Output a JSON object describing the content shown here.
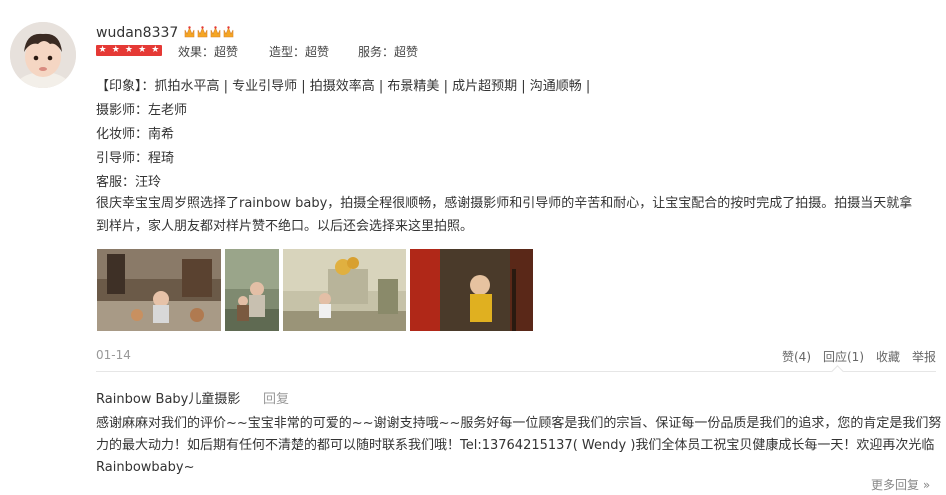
{
  "review": {
    "username": "wudan8337",
    "crown_count": 4,
    "star_rating": 5,
    "scores": [
      {
        "label": "效果：超赞"
      },
      {
        "label": "造型：超赞"
      },
      {
        "label": "服务：超赞"
      }
    ],
    "impression": "【印象】：抓拍水平高 | 专业引导师 | 拍摄效率高 | 布景精美 | 成片超预期 | 沟通顺畅 |",
    "photographer": "摄影师：左老师",
    "makeup_artist": "化妆师：南希",
    "guide": "引导师：程琦",
    "customer_service": "客服：汪玲",
    "text": "很庆幸宝宝周岁照选择了rainbow baby，拍摄全程很顺畅，感谢摄影师和引导师的辛苦和耐心，让宝宝配合的按时完成了拍摄。拍摄当天就拿到样片，家人朋友都对样片赞不绝口。以后还会选择来这里拍照。",
    "date": "01-14",
    "actions": {
      "like": "赞(4)",
      "reply": "回应(1)",
      "favorite": "收藏",
      "report": "举报"
    }
  },
  "merchant_reply": {
    "name": "Rainbow Baby儿童摄影",
    "reply_label": "回复",
    "text": "感谢麻麻对我们的评价~~宝宝非常的可爱的~~谢谢支持哦~~服务好每一位顾客是我们的宗旨、保证每一份品质是我们的追求，您的肯定是我们努力的最大动力！如后期有任何不清楚的都可以随时联系我们哦！Tel:13764215137( Wendy )我们全体员工祝宝贝健康成长每一天！欢迎再次光临Rainbowbaby~",
    "more_replies": "更多回复 »"
  },
  "colors": {
    "star_red": "#e53935",
    "crown_gold": "#f5a623",
    "muted_text": "#999999"
  }
}
